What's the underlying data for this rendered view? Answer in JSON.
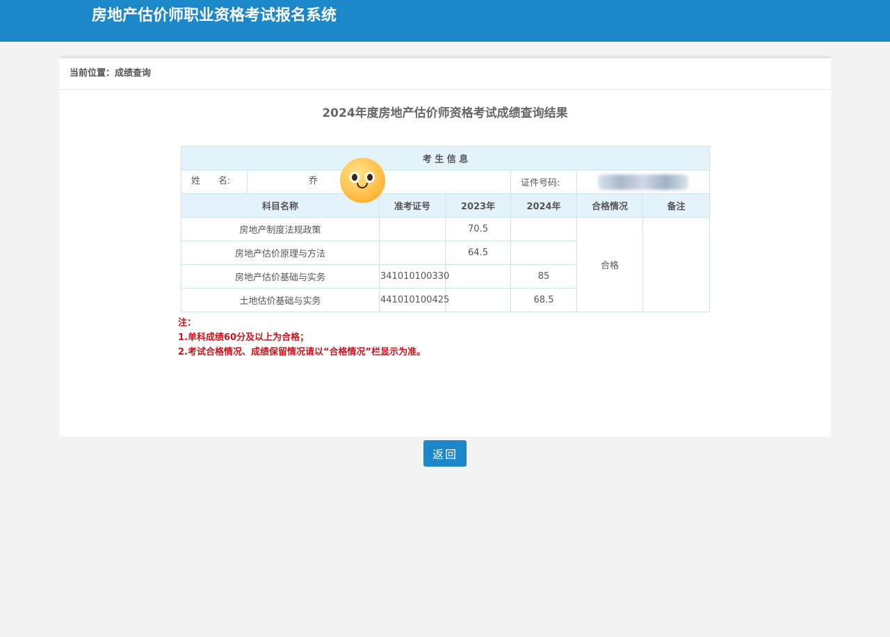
{
  "header": {
    "title": "房地产估价师职业资格考试报名系统"
  },
  "breadcrumb": {
    "text": "当前位置：成绩查询"
  },
  "result": {
    "title": "2024年度房地产估价师资格考试成绩查询结果"
  },
  "candidate": {
    "section_label": "考 生 信 息",
    "name_label": "姓　　名:",
    "name_value": "乔",
    "id_label": "证件号码:"
  },
  "columns": [
    "科目名称",
    "准考证号",
    "2023年",
    "2024年",
    "合格情况",
    "备注"
  ],
  "rows": [
    {
      "subject": "房地产制度法规政策",
      "ticket": "",
      "y2023": "70.5",
      "y2024": ""
    },
    {
      "subject": "房地产估价原理与方法",
      "ticket": "",
      "y2023": "64.5",
      "y2024": ""
    },
    {
      "subject": "房地产估价基础与实务",
      "ticket": "341010100330",
      "y2023": "",
      "y2024": "85"
    },
    {
      "subject": "土地估价基础与实务",
      "ticket": "441010100425",
      "y2023": "",
      "y2024": "68.5"
    }
  ],
  "status": {
    "pass": "合格",
    "remark": ""
  },
  "notes": {
    "title": "注：",
    "line1": "1.单科成绩60分及以上为合格；",
    "line2": "2.考试合格情况、成绩保留情况请以“合格情况”栏显示为准。"
  },
  "actions": {
    "back_label": "返回"
  },
  "theme": {
    "primary": "#1c87c9",
    "note_color": "#d0101b",
    "table_header_bg": "#e4f2fb"
  }
}
